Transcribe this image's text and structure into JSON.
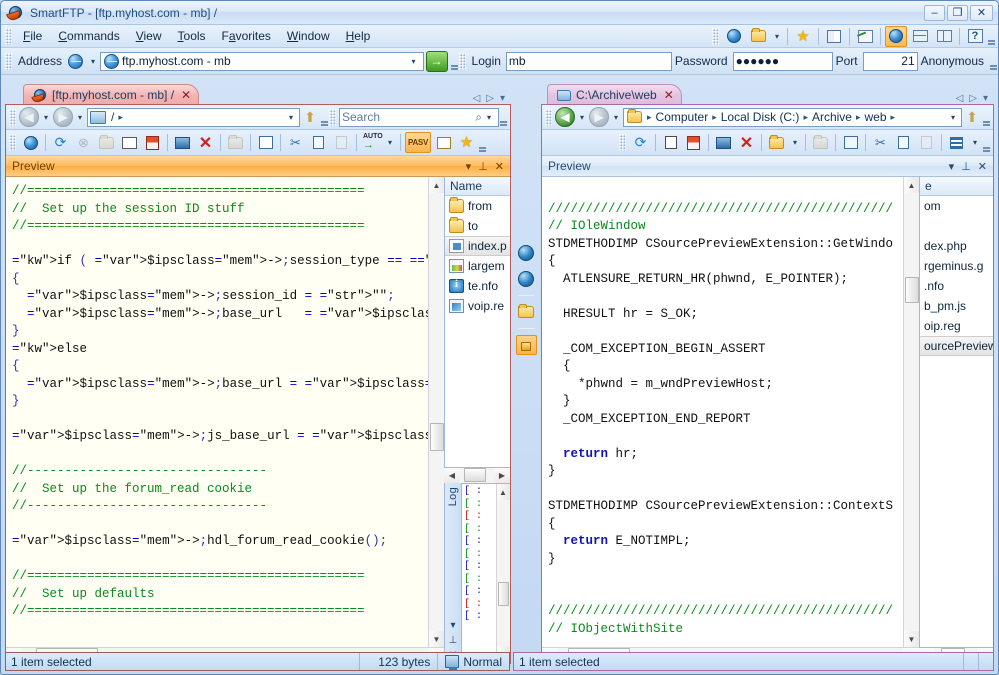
{
  "window": {
    "title": "SmartFTP - [ftp.myhost.com - mb] /",
    "icon": "smartftp-icon",
    "minimize": "–",
    "maximize": "❒",
    "close": "✕"
  },
  "menu": {
    "items": [
      {
        "label": "File",
        "accel": "F"
      },
      {
        "label": "Commands",
        "accel": "C"
      },
      {
        "label": "View",
        "accel": "V"
      },
      {
        "label": "Tools",
        "accel": "T"
      },
      {
        "label": "Favorites",
        "accel": "a"
      },
      {
        "label": "Window",
        "accel": "W"
      },
      {
        "label": "Help",
        "accel": "H"
      }
    ]
  },
  "toolbar": {
    "address_label": "Address",
    "address_value": "ftp.myhost.com - mb",
    "go_glyph": "→",
    "login_label": "Login",
    "login_value": "mb",
    "password_label": "Password",
    "password_value": "●●●●●●",
    "port_label": "Port",
    "port_value": "21",
    "anonymous_label": "Anonymous",
    "icons": [
      {
        "name": "new-remote-browser-icon",
        "glyph": ""
      },
      {
        "name": "open-folder-icon",
        "glyph": ""
      },
      {
        "name": "favorites-star-icon",
        "glyph": "★"
      },
      {
        "name": "address-book-icon",
        "glyph": ""
      },
      {
        "name": "transfer-graph-icon",
        "glyph": ""
      },
      {
        "name": "global-view-icon",
        "glyph": ""
      },
      {
        "name": "tile-horizontal-icon",
        "glyph": ""
      },
      {
        "name": "tile-vertical-icon",
        "glyph": ""
      },
      {
        "name": "help-icon",
        "glyph": "?"
      }
    ]
  },
  "left_pane": {
    "tab": {
      "label": "[ftp.myhost.com - mb] /",
      "close": "✕",
      "icon": "smartftp-remote-icon"
    },
    "nav": {
      "back": "◀",
      "forward": "▶",
      "path_icon": "remote-computer-icon",
      "path": "/",
      "up": "↑"
    },
    "search_placeholder": "Search",
    "toolbar_icons": [
      "connect-icon",
      "refresh-icon",
      "stop-icon",
      "open-icon",
      "console-icon",
      "queue-icon",
      "new-folder-icon",
      "delete-icon",
      "rename-icon",
      "edit-icon",
      "cut-icon",
      "copy-icon",
      "paste-icon",
      "transfer-mode-auto-icon",
      "pasv-toggle",
      "properties-icon",
      "favorite-add-icon"
    ],
    "pasv_label": "PASV",
    "auto_label": "AUTO",
    "preview": {
      "title": "Preview",
      "menu_glyph": "▾",
      "pin_glyph": "⚓",
      "close_glyph": "✕",
      "language": "php",
      "lines": [
        {
          "t": "cm",
          "s": "//============================================="
        },
        {
          "t": "cm",
          "s": "//  Set up the session ID stuff"
        },
        {
          "t": "cm",
          "s": "//============================================="
        },
        {
          "t": "blank",
          "s": ""
        },
        {
          "t": "php1",
          "s": "if ( $ipsclass->session_type == 'cookie' )"
        },
        {
          "t": "punc",
          "s": "{"
        },
        {
          "t": "php2",
          "s": "  $ipsclass->session_id = \"\";"
        },
        {
          "t": "php3",
          "s": "  $ipsclass->base_url   = $ipsclass->vars['boa"
        },
        {
          "t": "punc",
          "s": "}"
        },
        {
          "t": "kw",
          "s": "else"
        },
        {
          "t": "punc",
          "s": "{"
        },
        {
          "t": "php4",
          "s": "  $ipsclass->base_url = $ipsclass->vars['board"
        },
        {
          "t": "punc",
          "s": "}"
        },
        {
          "t": "blank",
          "s": ""
        },
        {
          "t": "php5",
          "s": "$ipsclass->js_base_url = $ipsclass->vars['boar"
        },
        {
          "t": "blank",
          "s": ""
        },
        {
          "t": "cm",
          "s": "//--------------------------------"
        },
        {
          "t": "cm",
          "s": "//  Set up the forum_read cookie"
        },
        {
          "t": "cm",
          "s": "//--------------------------------"
        },
        {
          "t": "blank",
          "s": ""
        },
        {
          "t": "php6",
          "s": "$ipsclass->hdl_forum_read_cookie();"
        },
        {
          "t": "blank",
          "s": ""
        },
        {
          "t": "cm",
          "s": "//============================================="
        },
        {
          "t": "cm",
          "s": "//  Set up defaults"
        },
        {
          "t": "cm",
          "s": "//============================================="
        }
      ]
    },
    "filelist": {
      "header": "Name",
      "items": [
        {
          "name": "from",
          "icon": "folder-icon",
          "selected": false
        },
        {
          "name": "to",
          "icon": "folder-icon",
          "selected": false
        },
        {
          "name": "index.p",
          "icon": "php-file-icon",
          "selected": true
        },
        {
          "name": "largem",
          "icon": "image-file-icon",
          "selected": false
        },
        {
          "name": "te.nfo",
          "icon": "nfo-file-icon",
          "selected": false
        },
        {
          "name": "voip.re",
          "icon": "registry-file-icon",
          "selected": false
        }
      ]
    },
    "log": {
      "label": "Log",
      "menu_glyph": "▾",
      "pin_glyph": "⚓",
      "close_glyph": "✕",
      "rows": [
        {
          "c": "b",
          "s": "[ :"
        },
        {
          "c": "g",
          "s": "[ :"
        },
        {
          "c": "r",
          "s": "[ :"
        },
        {
          "c": "g",
          "s": "[ :"
        },
        {
          "c": "b",
          "s": "[ :"
        },
        {
          "c": "g",
          "s": "[ :"
        },
        {
          "c": "b",
          "s": "[ :"
        },
        {
          "c": "g",
          "s": "[ :"
        },
        {
          "c": "b",
          "s": "[ :"
        },
        {
          "c": "r",
          "s": "[ :"
        },
        {
          "c": "b",
          "s": "[ :"
        }
      ]
    },
    "status": {
      "selection": "1 item selected",
      "size": "123  bytes",
      "transfer_mode": "Normal"
    }
  },
  "right_pane": {
    "tab": {
      "label": "C:\\Archive\\web",
      "close": "✕",
      "icon": "local-folder-icon"
    },
    "nav": {
      "back": "◀",
      "forward": "▶",
      "crumbs": [
        "Computer",
        "Local Disk (C:)",
        "Archive",
        "web"
      ],
      "crumb_sep": "▸",
      "up": "↑"
    },
    "toolbar_icons": [
      "refresh-icon",
      "upload-icon",
      "queue-icon",
      "console-icon",
      "delete-icon",
      "new-folder-icon",
      "rename-icon",
      "properties-icon",
      "cut-icon",
      "copy-icon",
      "paste-icon",
      "view-mode-icon"
    ],
    "preview": {
      "title": "Preview",
      "menu_glyph": "▾",
      "pin_glyph": "⚓",
      "close_glyph": "✕",
      "language": "cpp",
      "lines": [
        {
          "t": "blank",
          "s": ""
        },
        {
          "t": "cm",
          "s": "//////////////////////////////////////////////"
        },
        {
          "t": "cm",
          "s": "// IOleWindow"
        },
        {
          "t": "plain",
          "s": "STDMETHODIMP CSourcePreviewExtension::GetWindo"
        },
        {
          "t": "plain",
          "s": "{"
        },
        {
          "t": "plain",
          "s": "  ATLENSURE_RETURN_HR(phwnd, E_POINTER);"
        },
        {
          "t": "blank",
          "s": ""
        },
        {
          "t": "plain",
          "s": "  HRESULT hr = S_OK;"
        },
        {
          "t": "blank",
          "s": ""
        },
        {
          "t": "plain",
          "s": "  _COM_EXCEPTION_BEGIN_ASSERT"
        },
        {
          "t": "plain",
          "s": "  {"
        },
        {
          "t": "plain",
          "s": "    *phwnd = m_wndPreviewHost;"
        },
        {
          "t": "plain",
          "s": "  }"
        },
        {
          "t": "plain",
          "s": "  _COM_EXCEPTION_END_REPORT"
        },
        {
          "t": "blank",
          "s": ""
        },
        {
          "t": "ret",
          "s": "  return hr;"
        },
        {
          "t": "plain",
          "s": "}"
        },
        {
          "t": "blank",
          "s": ""
        },
        {
          "t": "plain",
          "s": "STDMETHODIMP CSourcePreviewExtension::ContextS"
        },
        {
          "t": "plain",
          "s": "{"
        },
        {
          "t": "ret",
          "s": "  return E_NOTIMPL;"
        },
        {
          "t": "plain",
          "s": "}"
        },
        {
          "t": "blank",
          "s": ""
        },
        {
          "t": "blank",
          "s": ""
        },
        {
          "t": "cm",
          "s": "//////////////////////////////////////////////"
        },
        {
          "t": "cm",
          "s": "// IObjectWithSite"
        }
      ]
    },
    "filelist": {
      "header": "e",
      "items": [
        {
          "name": "om",
          "icon": "folder-icon",
          "selected": false
        },
        {
          "name": "",
          "icon": "folder-icon",
          "selected": false
        },
        {
          "name": "dex.php",
          "icon": "php-file-icon",
          "selected": false
        },
        {
          "name": "rgeminus.g",
          "icon": "image-file-icon",
          "selected": false
        },
        {
          "name": ".nfo",
          "icon": "nfo-file-icon",
          "selected": false
        },
        {
          "name": "b_pm.js",
          "icon": "js-file-icon",
          "selected": false
        },
        {
          "name": "oip.reg",
          "icon": "registry-file-icon",
          "selected": false
        },
        {
          "name": "ourcePreview",
          "icon": "cpp-file-icon",
          "selected": true
        }
      ]
    },
    "status": {
      "selection": "1 item selected"
    }
  },
  "iconstrip": {
    "items": [
      {
        "name": "download-transfer-icon"
      },
      {
        "name": "upload-transfer-icon"
      },
      {
        "name": "folder-sync-icon"
      },
      {
        "name": "secure-lock-icon",
        "highlight": true
      }
    ]
  },
  "colors": {
    "accent_orange": "#ffae42",
    "tab_ftp": "#f3b3b3",
    "tab_local": "#e4c3e0",
    "comment_green": "#0a8a1e",
    "keyword_blue": "#0000c8",
    "variable_blue": "#1a6fd4",
    "member_purple": "#7a22b3",
    "frame_blue": "#5c87b8"
  }
}
